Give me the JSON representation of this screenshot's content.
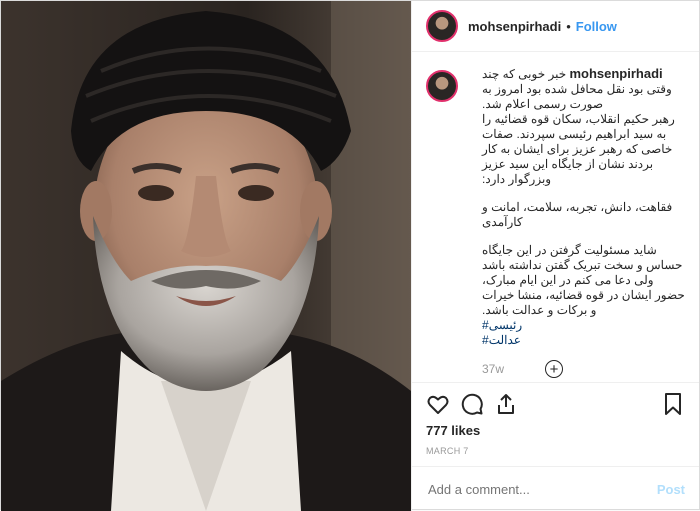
{
  "header": {
    "username": "mohsenpirhadi",
    "separator": "•",
    "follow_label": "Follow"
  },
  "caption": {
    "username": "mohsenpirhadi",
    "lines": [
      "خبر خوبی که چند وقتی بود نقل محافل شده بود امروز به صورت رسمی اعلام شد.",
      "رهبر حکیم انقلاب، سکان قوه قضائیه را به سید ابراهیم رئیسی سپردند. صفات خاصی که رهبر عزیز برای ایشان به کار بردند نشان از جایگاه این سید عزیز وبزرگوار دارد:",
      "فقاهت، دانش، تجربه، سلامت، امانت و کارآمدی",
      "شاید مسئولیت گرفتن در این جایگاه حساس و سخت تبریک گفتن نداشته باشد ولی دعا می کنم در این ایام مبارک، حضور ایشان در قوه قضائیه، منشا خیرات و برکات و عدالت باشد."
    ],
    "hashtags": [
      "#رئیسی",
      "#عدالت"
    ],
    "age": "37w"
  },
  "actions": {
    "like_icon": "heart-icon",
    "comment_icon": "comment-icon",
    "share_icon": "share-icon",
    "save_icon": "bookmark-icon",
    "more_icon": "plus-circle-icon"
  },
  "likes": "777 likes",
  "date": "MARCH 7",
  "comment": {
    "placeholder": "Add a comment...",
    "post_label": "Post"
  },
  "colors": {
    "accent": "#3897f0",
    "hashtag": "#003569",
    "post_disabled": "#b2dffc"
  }
}
